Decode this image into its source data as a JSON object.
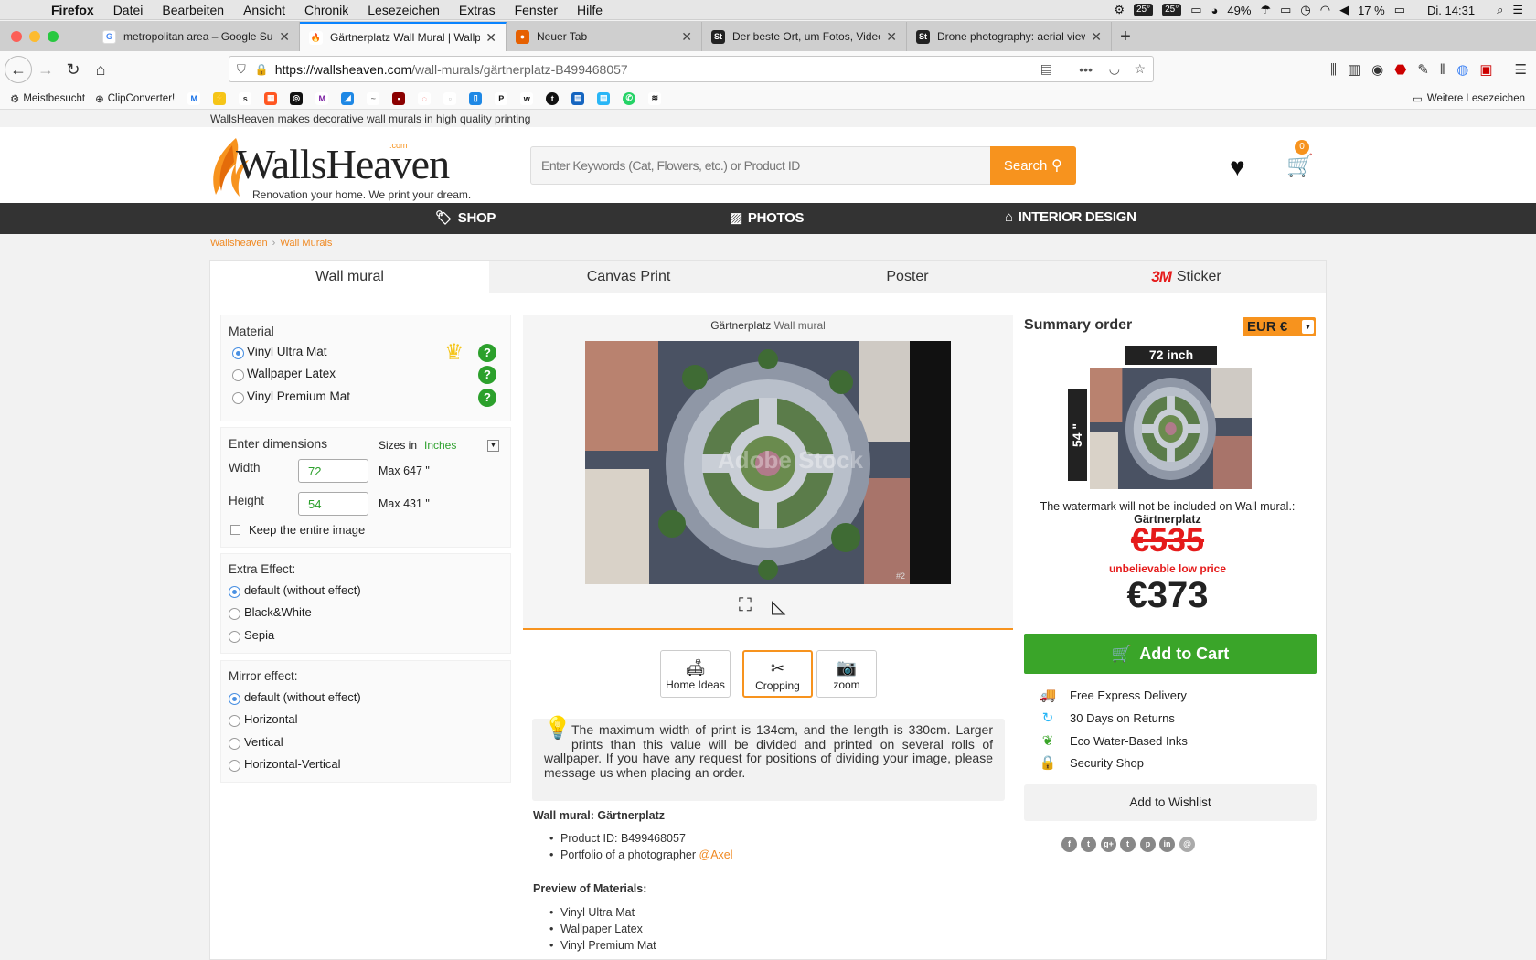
{
  "menubar": {
    "app": "Firefox",
    "items": [
      "Datei",
      "Bearbeiten",
      "Ansicht",
      "Chronik",
      "Lesezeichen",
      "Extras",
      "Fenster",
      "Hilfe"
    ],
    "temp1": "25°",
    "temp2": "25°",
    "cpu": "49%",
    "battery": "17 %",
    "clock": "Di. 14:31"
  },
  "tabs": [
    {
      "title": "metropolitan area – Google Suche",
      "favicon": "google-icon",
      "color": "#4285f4",
      "letter": "G"
    },
    {
      "title": "Gärtnerplatz Wall Mural | Wallpaper",
      "favicon": "wallsheaven-icon",
      "color": "#f7931e",
      "letter": "W"
    },
    {
      "title": "Neuer Tab",
      "favicon": "firefox-icon",
      "color": "#e66000",
      "letter": "F"
    },
    {
      "title": "Der beste Ort, um Fotos, Videos",
      "favicon": "stock-icon",
      "color": "#222",
      "letter": "St"
    },
    {
      "title": "Drone photography: aerial view",
      "favicon": "stock-icon",
      "color": "#222",
      "letter": "St"
    }
  ],
  "url": {
    "host": "https://wallsheaven.com",
    "path": "/wall-murals/gärtnerplatz-B499468057"
  },
  "bookmarks": {
    "most_visited": "Meistbesucht",
    "clipconverter": "ClipConverter!",
    "more": "Weitere Lesezeichen"
  },
  "site": {
    "tagline": "WallsHeaven makes decorative wall murals in high quality printing",
    "logo_word": "WallsHeaven",
    "logo_com": ".com",
    "logo_sub": "Renovation your home. We print your dream.",
    "search_placeholder": "Enter Keywords (Cat, Flowers, etc.) or Product ID",
    "search_label": "Search",
    "cart_count": "0",
    "nav": [
      "SHOP",
      "PHOTOS",
      "INTERIOR DESIGN"
    ],
    "breadcrumb": [
      "Wallsheaven",
      "Wall Murals"
    ]
  },
  "product_tabs": [
    "Wall mural",
    "Canvas Print",
    "Poster",
    "Sticker"
  ],
  "sticker_brand": "3M",
  "options": {
    "material_title": "Material",
    "materials": [
      "Vinyl Ultra Mat",
      "Wallpaper Latex",
      "Vinyl Premium Mat"
    ],
    "crown_number": "1",
    "dimensions_title": "Enter dimensions",
    "sizes_in": "Sizes in",
    "unit": "Inches",
    "width_label": "Width",
    "width_value": "72",
    "width_max": "Max 647 \"",
    "height_label": "Height",
    "height_value": "54",
    "height_max": "Max 431 \"",
    "keep_image": "Keep the entire image",
    "extra_title": "Extra Effect:",
    "extra": [
      "default (without effect)",
      "Black&White",
      "Sepia"
    ],
    "mirror_title": "Mirror effect:",
    "mirror": [
      "default (without effect)",
      "Horizontal",
      "Vertical",
      "Horizontal-Vertical"
    ]
  },
  "preview": {
    "title_name": "Gärtnerplatz",
    "title_suffix": "Wall mural",
    "watermark": "Adobe Stock",
    "image_id": "#2",
    "tools": [
      "Home Ideas",
      "Cropping",
      "zoom"
    ]
  },
  "notice": "The maximum width of print is 134cm, and the length is 330cm. Larger prints than this value will be divided and printed on several rolls of wallpaper. If you have any request for positions of dividing your image, please message us when placing an order.",
  "details": {
    "heading": "Wall mural: Gärtnerplatz",
    "product_id": "Product ID: B499468057",
    "portfolio": "Portfolio of a photographer",
    "photographer": "@Axel",
    "materials_heading": "Preview of Materials:",
    "materials": [
      "Vinyl Ultra Mat",
      "Wallpaper Latex",
      "Vinyl Premium Mat"
    ]
  },
  "summary": {
    "title": "Summary order",
    "currency": "EUR €",
    "width_label": "72 inch",
    "height_label": "54 \"",
    "watermark_note": "The watermark will not be included on Wall mural.:",
    "name": "Gärtnerplatz",
    "old_price": "€535",
    "promo": "unbelievable low price",
    "price": "€373",
    "add_to_cart": "Add to Cart",
    "features": [
      "Free Express Delivery",
      "30 Days on Returns",
      "Eco Water-Based Inks",
      "Security Shop"
    ],
    "wishlist": "Add to Wishlist",
    "social": [
      "f",
      "t",
      "g+",
      "t",
      "p",
      "in",
      "@"
    ]
  }
}
